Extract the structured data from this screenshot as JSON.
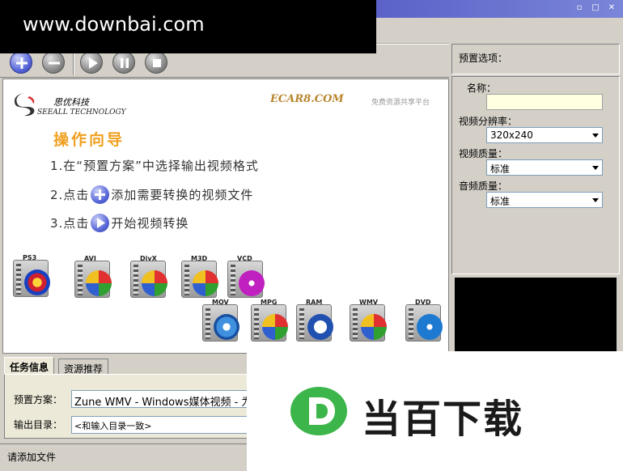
{
  "window": {
    "min_glyph": "▫",
    "max_glyph": "□",
    "close_glyph": "✕"
  },
  "watermark": {
    "top_text": "www.downbai.com",
    "bottom_text": "当百下载"
  },
  "toolbar": {
    "add_icon": "plus-circle-icon",
    "remove_icon": "minus-circle-icon",
    "play_icon": "play-icon",
    "pause_icon": "pause-icon",
    "stop_icon": "stop-icon"
  },
  "banner": {
    "company_cn": "思优科技",
    "company_en": "SEEALL TECHNOLOGY",
    "site": "ECAR8.COM",
    "slogan": "免费资源共享平台"
  },
  "guide": {
    "title": "操作向导",
    "step1": "1.在“预置方案”中选择输出视频格式",
    "step2_a": "2.点击",
    "step2_b": "添加需要转换的视频文件",
    "step3_a": "3.点击",
    "step3_b": "开始视频转换"
  },
  "formats": [
    "PS3",
    "AVI",
    "DivX",
    "M3D",
    "VCD",
    "MOV",
    "MPG",
    "RAM",
    "WMV",
    "DVD"
  ],
  "tabs": {
    "task_info": "任务信息",
    "resources": "资源推荐"
  },
  "task": {
    "preset_label": "预置方案：",
    "preset_value": "Zune WMV - Windows媒体视频 - 为Microsoft Zune",
    "output_label": "输出目录：",
    "output_value": "<和输入目录一致>"
  },
  "preset_options": {
    "header": "预置选项：",
    "name_label": "名称：",
    "name_value": "",
    "resolution_label": "视频分辨率：",
    "resolution_value": "320x240",
    "video_quality_label": "视频质量：",
    "video_quality_value": "标准",
    "audio_quality_label": "音频质量：",
    "audio_quality_value": "标准"
  },
  "status": {
    "text": "请添加文件"
  },
  "colors": {
    "titlebar": "#3b3bb5",
    "guide_title": "#f0a020",
    "accent_blue": "#5968d9",
    "watermark_green": "#3cb54a"
  }
}
